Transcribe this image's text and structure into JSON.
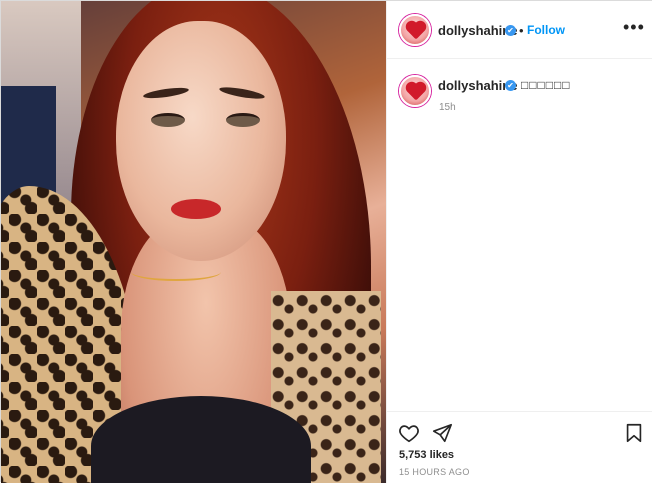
{
  "post": {
    "username": "dollyshahine",
    "verified_mark": "✔",
    "separator": "•",
    "follow_label": "Follow",
    "more_label": "•••",
    "caption_text": "□□□□□□",
    "caption_time": "15h",
    "likes_text": "5,753 likes",
    "date_text": "15 HOURS AGO"
  },
  "icons": {
    "like": "heart-outline-icon",
    "share": "paper-plane-icon",
    "save": "bookmark-icon",
    "more": "more-options-icon",
    "verified": "verified-badge-icon"
  },
  "colors": {
    "accent": "#0095f6",
    "verified": "#3897f0",
    "text": "#262626",
    "muted": "#8e8e8e",
    "border": "#dbdbdb"
  }
}
